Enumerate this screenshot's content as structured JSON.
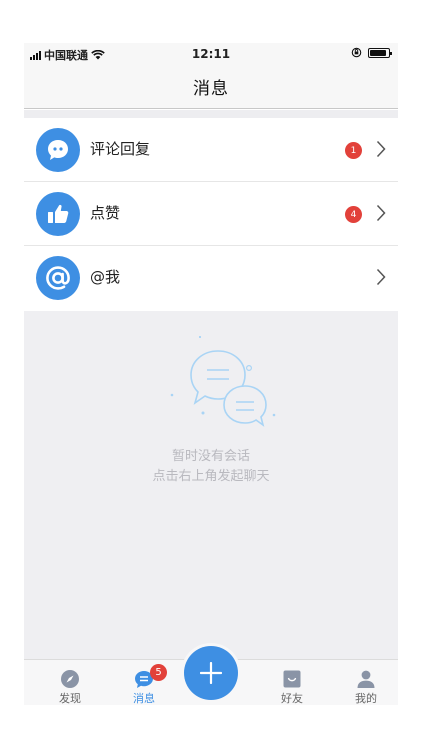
{
  "status_bar": {
    "carrier": "中国联通",
    "time": "12:11",
    "battery_level": 0.9
  },
  "nav": {
    "title": "消息"
  },
  "messages": [
    {
      "label": "评论回复",
      "icon": "comment-bubble-icon",
      "badge": "1"
    },
    {
      "label": "点赞",
      "icon": "thumbs-up-icon",
      "badge": "4"
    },
    {
      "label": "@我",
      "icon": "at-sign-icon",
      "badge": ""
    }
  ],
  "empty": {
    "line1": "暂时没有会话",
    "line2": "点击右上角发起聊天"
  },
  "tabs": {
    "discover": {
      "label": "发现",
      "icon": "compass-icon"
    },
    "messages": {
      "label": "消息",
      "icon": "chat-icon",
      "badge": "5"
    },
    "add": {
      "icon": "plus-icon"
    },
    "friends": {
      "label": "好友",
      "icon": "friends-icon"
    },
    "me": {
      "label": "我的",
      "icon": "person-icon"
    }
  },
  "colors": {
    "accent": "#3e8fe3",
    "badge": "#e2413a",
    "background": "#efeff2"
  }
}
